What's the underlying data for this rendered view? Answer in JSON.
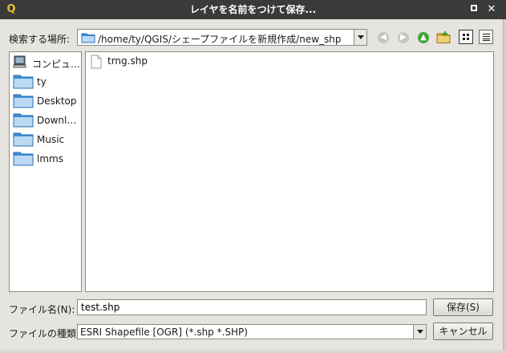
{
  "window": {
    "title": "レイヤを名前をつけて保存...",
    "app_icon": "qgis-icon",
    "app_icon_glyph": "Q",
    "close_glyph": "✕"
  },
  "toolbar": {
    "look_in_label": "検索する場所:",
    "path": "/home/ty/QGIS/シェープファイルを新規作成/new_shp",
    "buttons": {
      "back": {
        "icon": "back-arrow-icon",
        "glyph": "◀"
      },
      "forward": {
        "icon": "forward-arrow-icon",
        "glyph": "▶"
      },
      "up": {
        "icon": "up-arrow-icon",
        "glyph": "▲"
      },
      "new_folder": {
        "icon": "new-folder-icon"
      },
      "icon_view": {
        "icon": "icon-view-icon"
      },
      "detail_view": {
        "icon": "detail-view-icon"
      }
    }
  },
  "sidebar": {
    "items": [
      {
        "label": "コンピュ…",
        "icon": "computer-icon"
      },
      {
        "label": "ty",
        "icon": "folder-icon"
      },
      {
        "label": "Desktop",
        "icon": "folder-icon"
      },
      {
        "label": "Downl…",
        "icon": "folder-icon"
      },
      {
        "label": "Music",
        "icon": "folder-icon"
      },
      {
        "label": "lmms",
        "icon": "folder-icon"
      }
    ]
  },
  "files": [
    {
      "name": "trng.shp",
      "icon": "document-icon"
    }
  ],
  "form": {
    "filename_label": "ファイル名(N):",
    "filename_value": "test.shp",
    "filetype_label": "ファイルの種類:",
    "filetype_value": "ESRI Shapefile [OGR] (*.shp *.SHP)",
    "save_label": "保存(S)",
    "cancel_label": "キャンセル"
  },
  "colors": {
    "titlebar": "#3a3a3a",
    "folder_blue": "#3a8fd8",
    "up_green": "#3fa535"
  }
}
